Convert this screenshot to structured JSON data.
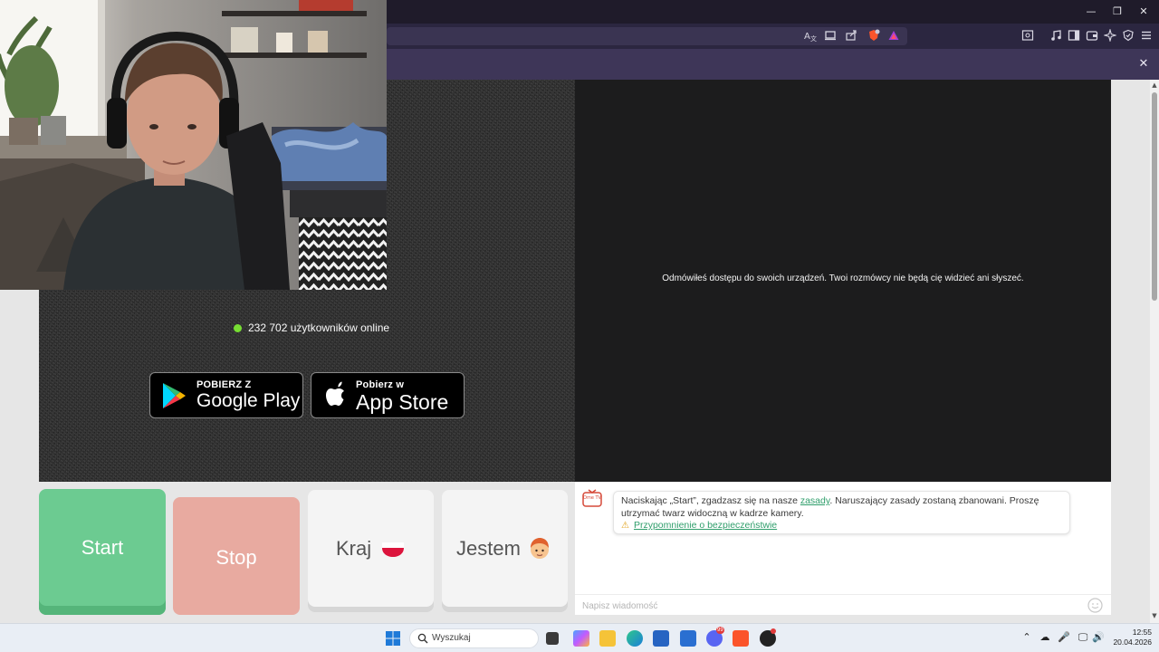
{
  "window": {
    "minimize_glyph": "—",
    "maximize_glyph": "❐",
    "close_glyph": "✕"
  },
  "sidepanel": {
    "close_glyph": "✕"
  },
  "stats": {
    "online_text": "232 702 użytkowników online",
    "dot_color": "#77dd33"
  },
  "stores": {
    "google": {
      "small": "POBIERZ Z",
      "big": "Google Play"
    },
    "apple": {
      "small": "Pobierz w",
      "big": "App Store"
    }
  },
  "remote": {
    "message": "Odmówiłeś dostępu do swoich urządzeń. Twoi rozmówcy nie będą cię widzieć ani słyszeć."
  },
  "controls": {
    "start_label": "Start",
    "stop_label": "Stop",
    "country_label": "Kraj",
    "gender_label": "Jestem",
    "start_color": "#6ccb91",
    "stop_color": "#e8aaa0"
  },
  "chat": {
    "rules_before": "Naciskając „Start”, zgadzasz się na nasze ",
    "rules_link": "zasady",
    "rules_after": ". Naruszający zasady zostaną zbanowani. Proszę utrzymać twarz widoczną w kadrze kamery.",
    "safety_link": "Przypomnienie o bezpieczeństwie",
    "input_placeholder": "Napisz wiadomość",
    "logo_text": "Ome TV"
  },
  "taskbar": {
    "search_label": "Wyszukaj",
    "time": "12:55",
    "date": "20.04.2026",
    "notification_badge": "99"
  }
}
